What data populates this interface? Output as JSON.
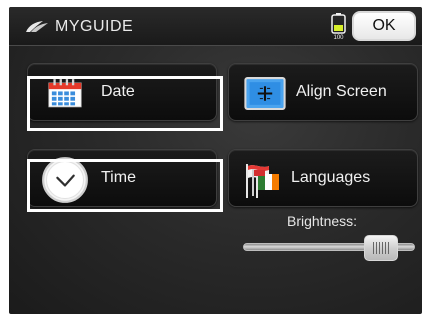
{
  "header": {
    "brand": "MYGUIDE",
    "ok_label": "OK",
    "battery_text": "100"
  },
  "tiles": {
    "date_label": "Date",
    "align_label": "Align Screen",
    "time_label": "Time",
    "languages_label": "Languages"
  },
  "brightness": {
    "label": "Brightness:",
    "level": 0.8
  },
  "colors": {
    "highlight": "#ffffff",
    "background": "#2a2a2a"
  },
  "icons": {
    "logo": "myguide-logo-icon",
    "battery": "battery-icon",
    "date": "calendar-icon",
    "align": "crosshair-icon",
    "time": "clock-icon",
    "languages": "flags-icon"
  }
}
